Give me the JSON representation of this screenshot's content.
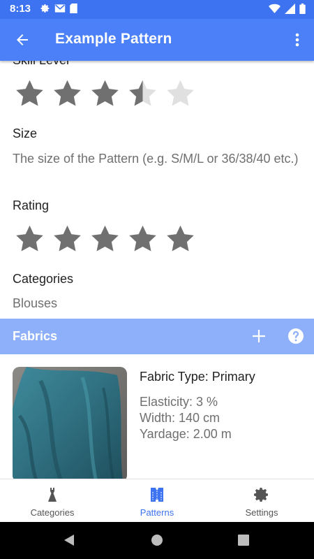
{
  "status_bar": {
    "time": "8:13"
  },
  "app_bar": {
    "title": "Example Pattern"
  },
  "fields": {
    "skill_level_label": "Skill Level",
    "skill_level_value": 3.5,
    "size_label": "Size",
    "size_value": "The size of the Pattern (e.g. S/M/L or 36/38/40 etc.)",
    "rating_label": "Rating",
    "rating_value": 5,
    "categories_label": "Categories",
    "categories_value": "Blouses"
  },
  "fabrics": {
    "section_title": "Fabrics",
    "items": [
      {
        "type": "Fabric Type: Primary",
        "elasticity": "Elasticity: 3 %",
        "width": "Width: 140 cm",
        "yardage": "Yardage: 2.00 m"
      }
    ]
  },
  "bottom_nav": {
    "items": [
      {
        "label": "Categories",
        "icon": "dress-icon",
        "active": false
      },
      {
        "label": "Patterns",
        "icon": "pattern-icon",
        "active": true
      },
      {
        "label": "Settings",
        "icon": "gear-icon",
        "active": false
      }
    ]
  },
  "colors": {
    "status_bar": "#3d73f0",
    "app_bar": "#4b80f8",
    "section_bar": "#8eb0fa",
    "star_filled": "#707070",
    "star_empty": "#e0e0e0",
    "nav_active": "#3d73f0"
  }
}
